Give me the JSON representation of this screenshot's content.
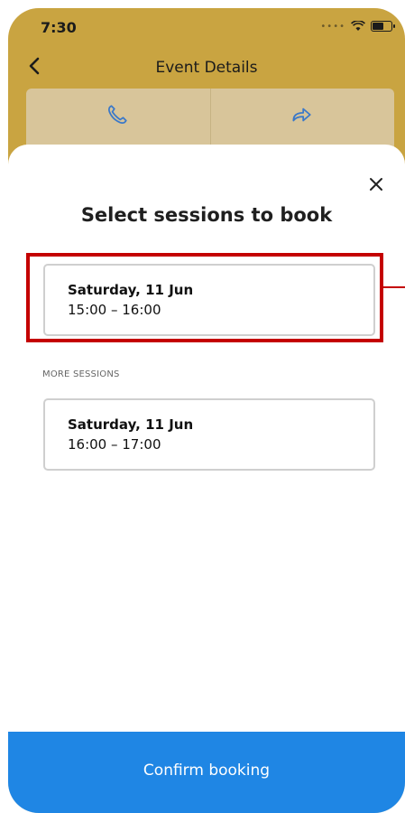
{
  "status_bar": {
    "time": "7:30",
    "icons": [
      "signal-dots-icon",
      "wifi-icon",
      "battery-icon"
    ]
  },
  "header": {
    "back_icon": "chevron-left-icon",
    "title": "Event Details"
  },
  "behind_actions": {
    "icons": [
      "phone-icon",
      "share-arrow-icon"
    ]
  },
  "sheet": {
    "close_icon": "close-icon",
    "title": "Select sessions to book",
    "selected_session": {
      "date": "Saturday, 11 Jun",
      "time": "15:00 – 16:00"
    },
    "more_label": "MORE SESSIONS",
    "sessions": [
      {
        "date": "Saturday, 11 Jun",
        "time": "16:00 – 17:00"
      }
    ],
    "confirm_label": "Confirm booking"
  },
  "colors": {
    "header_bg": "#c9a441",
    "highlight": "#c40000",
    "confirm_bg": "#1f86e4"
  }
}
